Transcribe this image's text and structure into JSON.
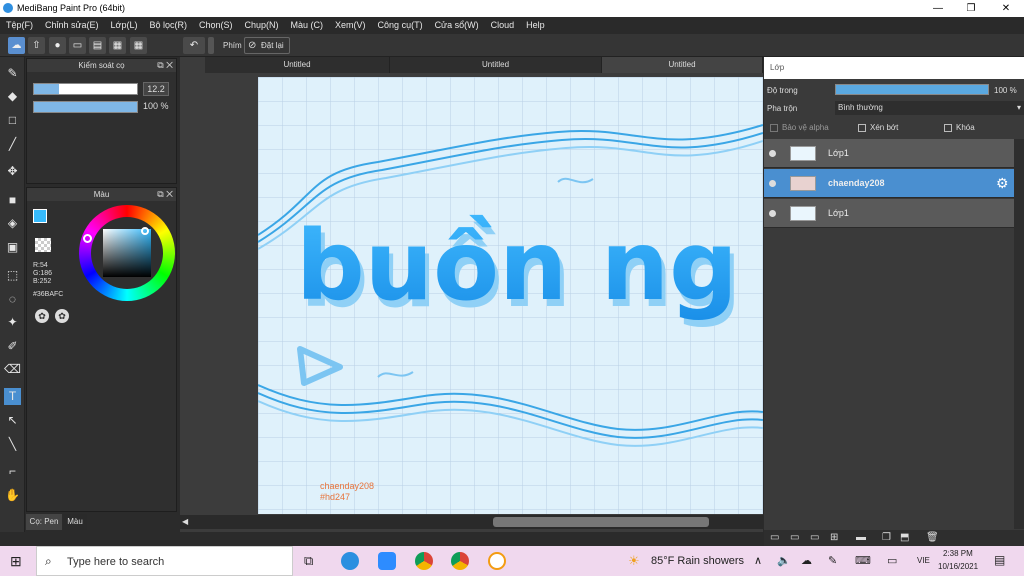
{
  "window": {
    "title": "MediBang Paint Pro (64bit)",
    "minimize": "—",
    "maximize": "❐",
    "close": "✕"
  },
  "menu": [
    "Tệp(F)",
    "Chỉnh sửa(E)",
    "Lớp(L)",
    "Bộ lọc(R)",
    "Chọn(S)",
    "Chụp(N)",
    "Màu (C)",
    "Xem(V)",
    "Công cụ(T)",
    "Cửa sổ(W)",
    "Cloud",
    "Help"
  ],
  "toolbar": {
    "phim_label": "Phím",
    "reset_label": "Đặt lại"
  },
  "brush_panel": {
    "title": "Kiểm soát cọ",
    "size_value": "12.2",
    "opacity_value": "100 %"
  },
  "color_panel": {
    "title": "Màu",
    "rgb_r": "R:54",
    "rgb_g": "G:186",
    "rgb_b": "B:252",
    "hex": "#36BAFC",
    "fg_color": "#36BAFC"
  },
  "bottom_tabs": {
    "brush_tab": "Cọ: Pen",
    "color_tab": "Màu"
  },
  "doc_tabs": [
    "Untitled",
    "Untitled",
    "Untitled"
  ],
  "canvas": {
    "main_text": "buồn ng",
    "watermark_line1": "chaenday208",
    "watermark_line2": "#hd247"
  },
  "layer_panel": {
    "title": "Lớp",
    "opacity_label": "Độ trong",
    "opacity_value": "100 %",
    "blend_label": "Pha trộn",
    "blend_value": "Bình thường",
    "protect_alpha": "Bảo vệ alpha",
    "clipping": "Xén bớt",
    "lock": "Khóa",
    "layers": [
      {
        "name": "Lớp1",
        "selected": false
      },
      {
        "name": "chaenday208",
        "selected": true
      },
      {
        "name": "Lớp1",
        "selected": false
      }
    ]
  },
  "taskbar": {
    "search_placeholder": "Type here to search",
    "weather": "85°F  Rain showers",
    "lang": "VIE",
    "time": "2:38 PM",
    "date": "10/16/2021"
  }
}
